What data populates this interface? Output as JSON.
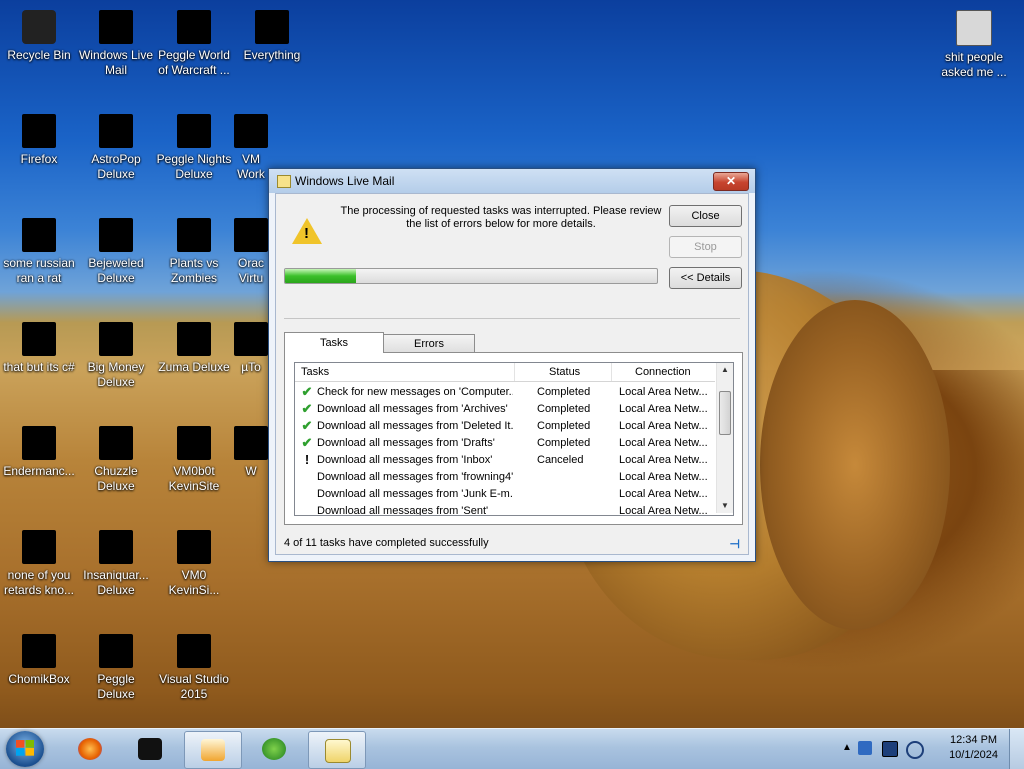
{
  "desktop": {
    "icons": [
      {
        "label": "Recycle Bin",
        "color": "#000000"
      },
      {
        "label": "Windows Live Mail",
        "color": "#000000"
      },
      {
        "label": "Peggle World of Warcraft ...",
        "color": "#000000"
      },
      {
        "label": "Everything",
        "color": "#000000"
      },
      {
        "label": "shit people asked me ...",
        "color": "#000000"
      },
      {
        "label": "Firefox",
        "color": "#000000"
      },
      {
        "label": "AstroPop Deluxe",
        "color": "#000000"
      },
      {
        "label": "Peggle Nights Deluxe",
        "color": "#000000"
      },
      {
        "label": "VM Work",
        "color": "#000000"
      },
      {
        "label": "some russian ran a rat",
        "color": "#000000"
      },
      {
        "label": "Bejeweled Deluxe",
        "color": "#000000"
      },
      {
        "label": "Plants vs Zombies",
        "color": "#000000"
      },
      {
        "label": "Orac Virtu",
        "color": "#000000"
      },
      {
        "label": "that but its c#",
        "color": "#000000"
      },
      {
        "label": "Big Money Deluxe",
        "color": "#000000"
      },
      {
        "label": "Zuma Deluxe",
        "color": "#000000"
      },
      {
        "label": "µTo",
        "color": "#000000"
      },
      {
        "label": "Endermanc...",
        "color": "#000000"
      },
      {
        "label": "Chuzzle Deluxe",
        "color": "#000000"
      },
      {
        "label": "VM0b0t KevinSite",
        "color": "#000000"
      },
      {
        "label": "W",
        "color": "#000000"
      },
      {
        "label": "none of you retards kno...",
        "color": "#000000"
      },
      {
        "label": "Insaniquar... Deluxe",
        "color": "#000000"
      },
      {
        "label": "VM0 KevinSi...",
        "color": "#000000"
      },
      {
        "label": "ChomikBox",
        "color": "#000000"
      },
      {
        "label": "Peggle Deluxe",
        "color": "#000000"
      },
      {
        "label": "Visual Studio 2015",
        "color": "#000000"
      }
    ]
  },
  "dialog": {
    "title": "Windows Live Mail",
    "close_x": "✕",
    "message": "The processing of requested tasks was interrupted.  Please review the list of errors below for more details.",
    "buttons": {
      "close": "Close",
      "stop": "Stop",
      "details": "<< Details"
    },
    "progress": 0.19,
    "tabs": {
      "tasks": "Tasks",
      "errors": "Errors"
    },
    "columns": {
      "tasks": "Tasks",
      "status": "Status",
      "connection": "Connection"
    },
    "rows": [
      {
        "icon": "check-icon",
        "task": "Check for new messages on 'Computer...",
        "status": "Completed",
        "connection": "Local Area Netw..."
      },
      {
        "icon": "check-icon",
        "task": "Download all messages from 'Archives'",
        "status": "Completed",
        "connection": "Local Area Netw..."
      },
      {
        "icon": "check-icon",
        "task": "Download all messages from 'Deleted It...",
        "status": "Completed",
        "connection": "Local Area Netw..."
      },
      {
        "icon": "check-icon",
        "task": "Download all messages from 'Drafts'",
        "status": "Completed",
        "connection": "Local Area Netw..."
      },
      {
        "icon": "warning-icon",
        "task": "Download all messages from 'Inbox'",
        "status": "Canceled",
        "connection": "Local Area Netw..."
      },
      {
        "icon": "",
        "task": "Download all messages from 'frowning4'",
        "status": "",
        "connection": "Local Area Netw..."
      },
      {
        "icon": "",
        "task": "Download all messages from 'Junk E-m...",
        "status": "",
        "connection": "Local Area Netw..."
      },
      {
        "icon": "",
        "task": "Download all messages from 'Sent'",
        "status": "",
        "connection": "Local Area Netw..."
      }
    ],
    "summary": "4 of 11 tasks have completed successfully"
  },
  "taskbar": {
    "clock_time": "12:34 PM",
    "clock_date": "10/1/2024",
    "items": [
      "firefox-icon",
      "media-icon",
      "media-player-icon",
      "download-manager-icon",
      "windows-live-mail-icon"
    ]
  }
}
